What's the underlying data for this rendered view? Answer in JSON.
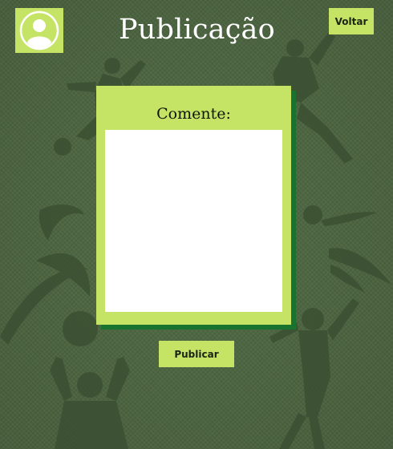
{
  "header": {
    "title": "Publicação",
    "back_label": "Voltar",
    "avatar_icon": "user-circle-icon"
  },
  "form": {
    "label": "Comente:",
    "comment_value": "",
    "submit_label": "Publicar"
  },
  "colors": {
    "background": "#4c6440",
    "accent": "#c5e466",
    "card_shadow": "#17732e",
    "title_text": "#ffffff"
  },
  "background_art": {
    "icons": [
      "volleyball-player-icon",
      "volleyball-icon",
      "soccer-ball-icon",
      "swoosh-icon"
    ]
  }
}
